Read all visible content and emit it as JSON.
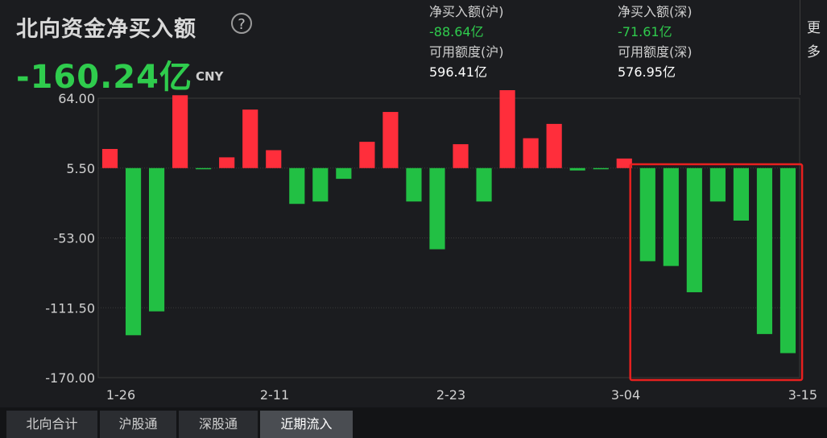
{
  "header": {
    "title": "北向资金净买入额",
    "help_icon": "?",
    "net_value": "-160.24亿",
    "currency": "CNY",
    "sh_net_label": "净买入额(沪)",
    "sh_net_value": "-88.64亿",
    "sz_net_label": "净买入额(深)",
    "sz_net_value": "-71.61亿",
    "sh_quota_label": "可用额度(沪)",
    "sh_quota_value": "596.41亿",
    "sz_quota_label": "可用额度(深)",
    "sz_quota_value": "576.95亿",
    "more_label": "更 多"
  },
  "tabs": [
    {
      "label": "北向合计",
      "active": false
    },
    {
      "label": "沪股通",
      "active": false
    },
    {
      "label": "深股通",
      "active": false
    },
    {
      "label": "近期流入",
      "active": true
    }
  ],
  "colors": {
    "positive": "#ff2e3b",
    "negative": "#22c044",
    "highlight": "#e8201f",
    "grid": "#3a3a3a"
  },
  "chart_data": {
    "type": "bar",
    "y_ticks": [
      "64.00",
      "5.50",
      "-53.00",
      "-111.50",
      "-170.00"
    ],
    "x_ticks": [
      "1-26",
      "2-11",
      "2-23",
      "3-04",
      "3-15"
    ],
    "ylim": [
      -170,
      64
    ],
    "baseline": 5.5,
    "values": [
      16,
      -140,
      -120,
      61,
      -1,
      9,
      49,
      15,
      -30,
      -28,
      -9,
      22,
      47,
      -28,
      -68,
      20,
      -28,
      72,
      25,
      37,
      -2,
      -1,
      8,
      -78,
      -82,
      -104,
      -28,
      -44,
      -139,
      -155
    ],
    "highlight_range": [
      23,
      29
    ]
  }
}
